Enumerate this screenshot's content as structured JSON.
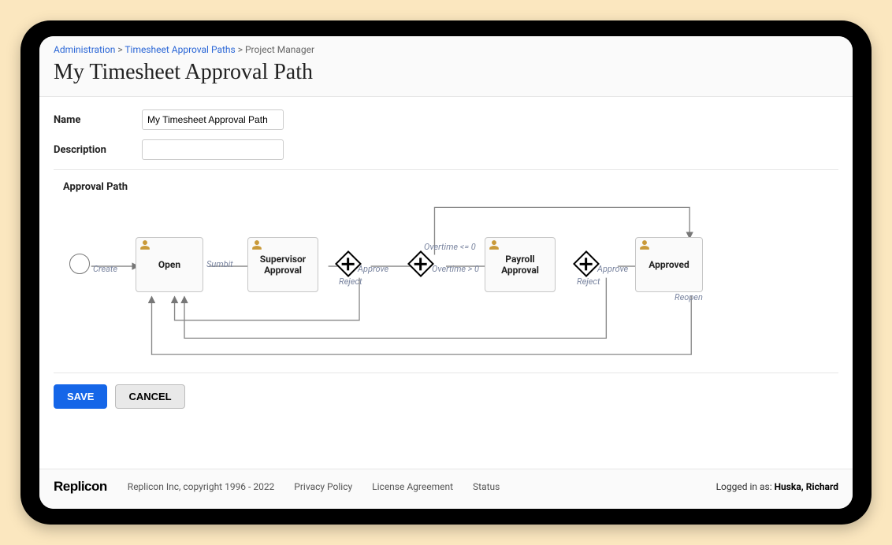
{
  "breadcrumbs": {
    "admin": "Administration",
    "paths": "Timesheet Approval Paths",
    "current": "Project Manager"
  },
  "page_title": "My Timesheet Approval Path",
  "form": {
    "name_label": "Name",
    "name_value": "My Timesheet Approval Path",
    "description_label": "Description",
    "description_value": ""
  },
  "section_label": "Approval Path",
  "nodes": {
    "open": "Open",
    "supervisor": "Supervisor Approval",
    "payroll": "Payroll Approval",
    "approved": "Approved"
  },
  "edges": {
    "create": "Create",
    "submit": "Sumbit",
    "approve1": "Approve",
    "reject1": "Reject",
    "ot_le0": "Overtime <= 0",
    "ot_gt0": "Overtime > 0",
    "approve2": "Approve",
    "reject2": "Reject",
    "reopen": "Reopen"
  },
  "buttons": {
    "save": "SAVE",
    "cancel": "CANCEL"
  },
  "footer": {
    "brand": "Replicon",
    "copyright": "Replicon Inc, copyright 1996 - 2022",
    "privacy": "Privacy Policy",
    "license": "License Agreement",
    "status": "Status",
    "logged_in_prefix": "Logged in as: ",
    "user": "Huska, Richard"
  }
}
